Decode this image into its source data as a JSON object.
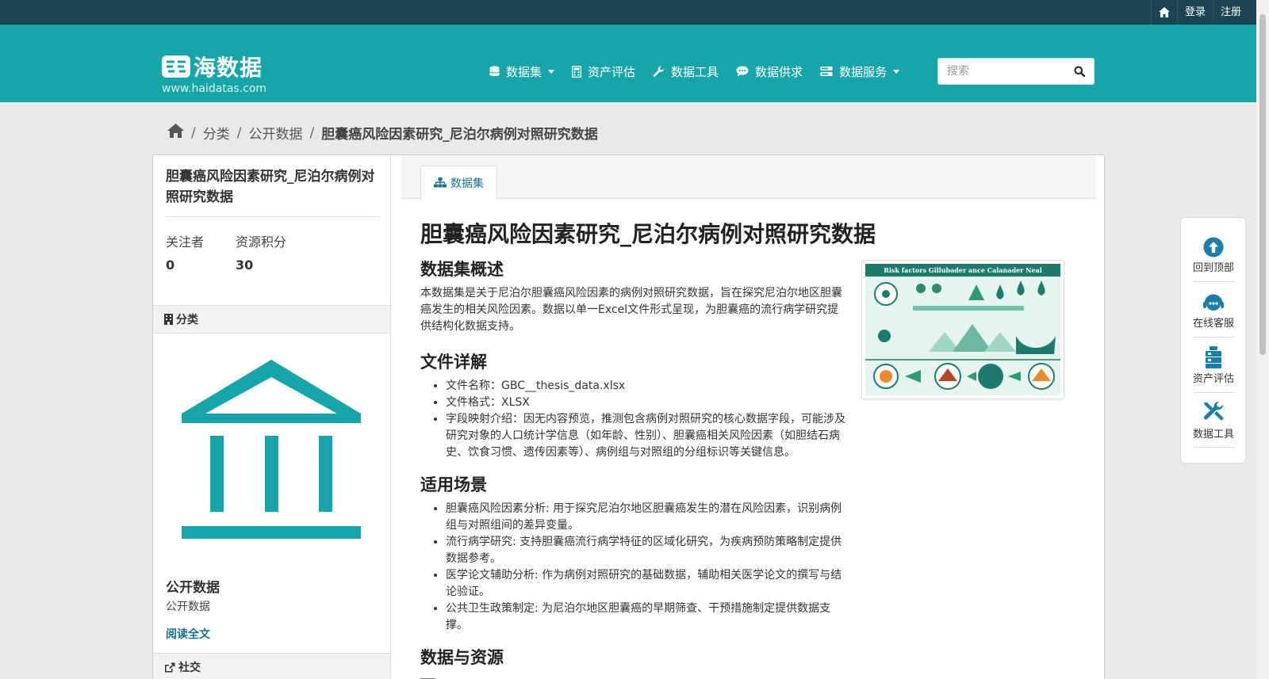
{
  "topbar": {
    "login": "登录",
    "register": "注册"
  },
  "brand": {
    "name": "海数据",
    "url": "www.haidatas.com"
  },
  "nav": [
    {
      "label": "数据集",
      "icon": "database-icon",
      "dropdown": true
    },
    {
      "label": "资产评估",
      "icon": "calculator-icon",
      "dropdown": false
    },
    {
      "label": "数据工具",
      "icon": "wrench-icon",
      "dropdown": false
    },
    {
      "label": "数据供求",
      "icon": "chat-icon",
      "dropdown": false
    },
    {
      "label": "数据服务",
      "icon": "server-icon",
      "dropdown": true
    }
  ],
  "search": {
    "placeholder": "搜索",
    "value": ""
  },
  "breadcrumb": {
    "cat": "分类",
    "org": "公开数据",
    "current": "胆囊癌风险因素研究_尼泊尔病例对照研究数据"
  },
  "sidebar": {
    "title": "胆囊癌风险因素研究_尼泊尔病例对照研究数据",
    "followers_label": "关注者",
    "followers_value": "0",
    "points_label": "资源积分",
    "points_value": "30",
    "category_heading": "分类",
    "org_name": "公开数据",
    "org_desc": "公开数据",
    "read_more": "阅读全文",
    "social_heading": "社交"
  },
  "tab": {
    "label": "数据集"
  },
  "dataset": {
    "title": "胆囊癌风险因素研究_尼泊尔病例对照研究数据",
    "overview_heading": "数据集概述",
    "overview_text": "本数据集是关于尼泊尔胆囊癌风险因素的病例对照研究数据，旨在探究尼泊尔地区胆囊癌发生的相关风险因素。数据以单一Excel文件形式呈现，为胆囊癌的流行病学研究提供结构化数据支持。",
    "files_heading": "文件详解",
    "files": [
      "文件名称：GBC__thesis_data.xlsx",
      "文件格式：XLSX",
      "字段映射介绍：因无内容预览，推测包含病例对照研究的核心数据字段，可能涉及研究对象的人口统计学信息（如年龄、性别）、胆囊癌相关风险因素（如胆结石病史、饮食习惯、遗传因素等）、病例组与对照组的分组标识等关键信息。"
    ],
    "scenarios_heading": "适用场景",
    "scenarios": [
      "胆囊癌风险因素分析: 用于探究尼泊尔地区胆囊癌发生的潜在风险因素，识别病例组与对照组间的差异变量。",
      "流行病学研究: 支持胆囊癌流行病学特征的区域化研究，为疾病预防策略制定提供数据参考。",
      "医学论文辅助分析: 作为病例对照研究的基础数据，辅助相关医学论文的撰写与结论验证。",
      "公共卫生政策制定: 为尼泊尔地区胆囊癌的早期筛查、干预措施制定提供数据支撑。"
    ],
    "resources_heading": "数据与资源",
    "thumbnail_title": "Risk factors Gillubader ance Calanader Neal"
  },
  "float_panel": [
    {
      "label": "回到顶部",
      "icon": "arrow-up-circle-icon"
    },
    {
      "label": "在线客服",
      "icon": "headset-icon"
    },
    {
      "label": "资产评估",
      "icon": "stack-icon"
    },
    {
      "label": "数据工具",
      "icon": "tools-icon"
    }
  ],
  "colors": {
    "brand": "#18a5aa",
    "topbar": "#1b4554",
    "link": "#1a7089"
  }
}
